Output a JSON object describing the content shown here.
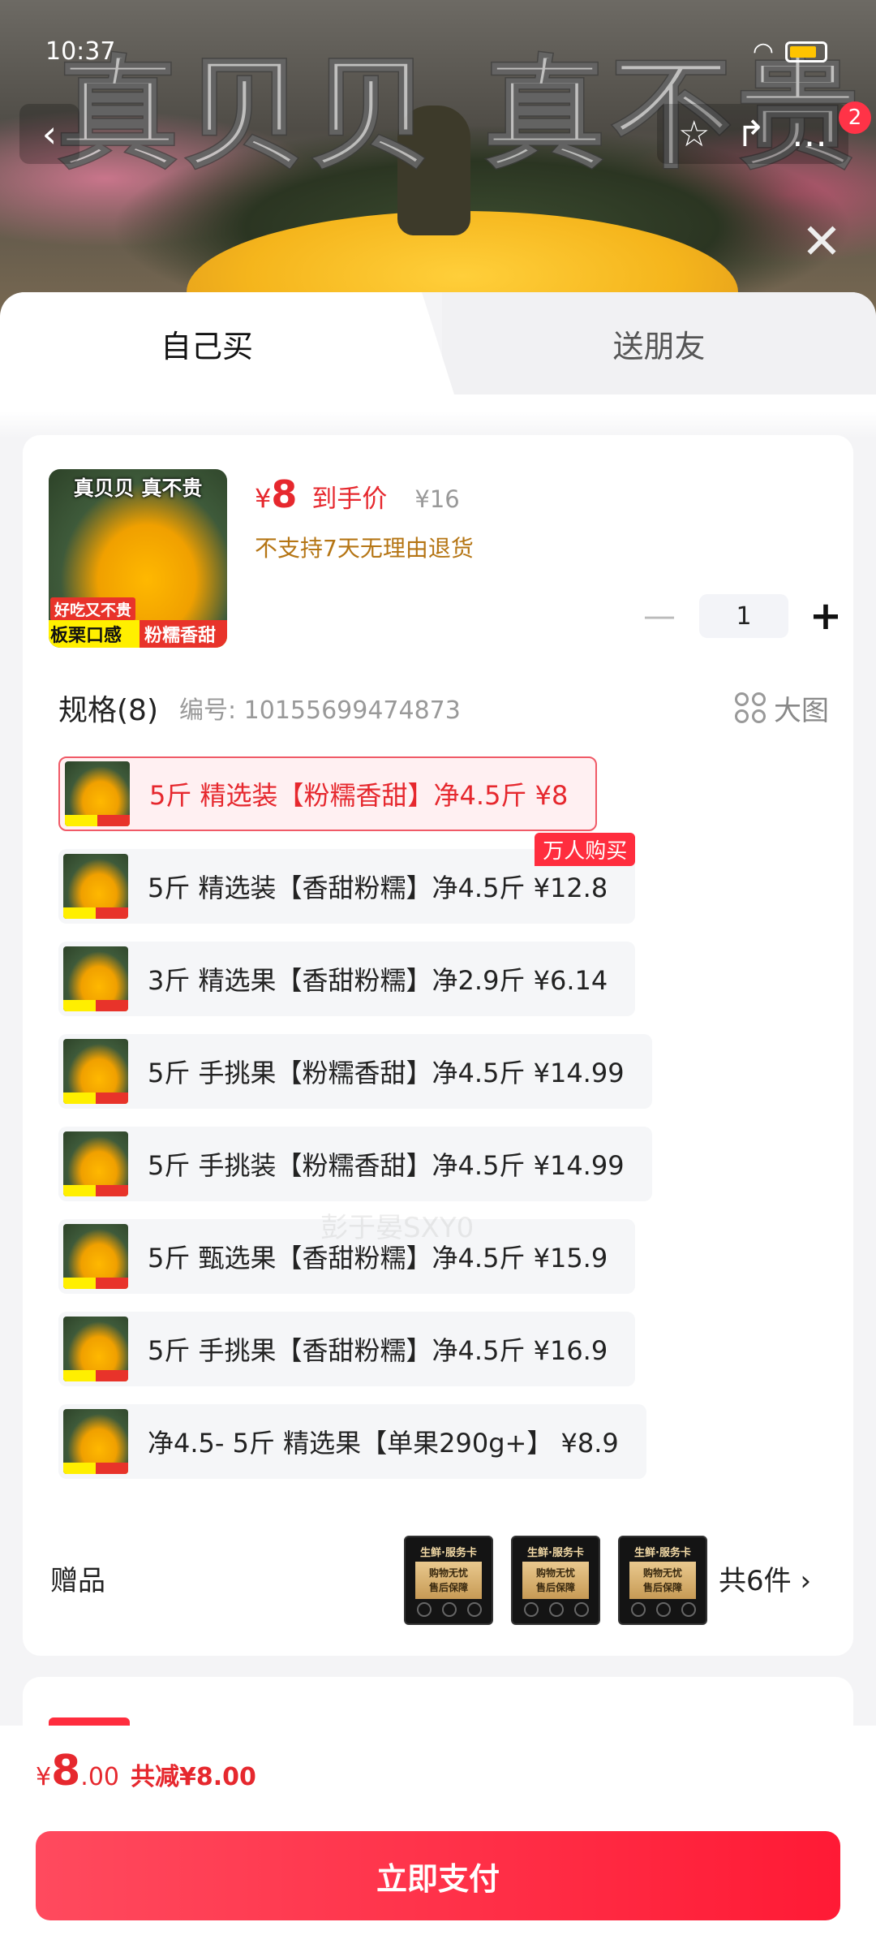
{
  "status_bar": {
    "time": "10:37",
    "battery": "81"
  },
  "hero": {
    "title": "真贝贝 真不贵",
    "cart_badge": "2"
  },
  "tabs": {
    "self": "自己买",
    "friend": "送朋友"
  },
  "product": {
    "thumb_title": "真贝贝 真不贵",
    "thumb_tag": "好吃又不贵",
    "thumb_bar_left": "板栗口感",
    "thumb_bar_right": "粉糯香甜",
    "price_symbol": "¥",
    "price": "8",
    "price_label": "到手价",
    "original_price": "¥16",
    "return_policy": "不支持7天无理由退货",
    "quantity": "1"
  },
  "spec": {
    "title": "规格(8)",
    "code": "编号: 10155699474873",
    "big_image_label": "大图",
    "options": [
      {
        "label": "5斤 精选装【粉糯香甜】净4.5斤  ¥8",
        "selected": true
      },
      {
        "label": "5斤 精选装【香甜粉糯】净4.5斤  ¥12.8",
        "badge": "万人购买"
      },
      {
        "label": "3斤 精选果【香甜粉糯】净2.9斤  ¥6.14"
      },
      {
        "label": "5斤 手挑果【粉糯香甜】净4.5斤  ¥14.99"
      },
      {
        "label": "5斤 手挑装【粉糯香甜】净4.5斤  ¥14.99"
      },
      {
        "label": "5斤 甄选果【香甜粉糯】净4.5斤  ¥15.9"
      },
      {
        "label": "5斤 手挑果【香甜粉糯】净4.5斤  ¥16.9"
      },
      {
        "label": "净4.5- 5斤 精选果【单果290g+】  ¥8.9"
      }
    ]
  },
  "gift": {
    "label": "赠品",
    "card_title": "生鲜·服务卡",
    "card_line1": "购物无忧",
    "card_line2": "售后保障",
    "count": "共6件 ›"
  },
  "watermark": "彭于晏SXY0",
  "footer": {
    "price_symbol": "¥",
    "price_int": "8",
    "price_dec": ".00",
    "saving": "共减¥8.00",
    "pay_button": "立即支付"
  },
  "colors": {
    "accent": "#e6282e",
    "pay_button": "#ff1a35",
    "badge": "#ff2d3e"
  },
  "icons": [
    "back-arrow-icon",
    "star-icon",
    "share-icon",
    "more-icon",
    "close-icon",
    "minus-icon",
    "plus-icon",
    "grid-icon",
    "chevron-right-icon"
  ]
}
